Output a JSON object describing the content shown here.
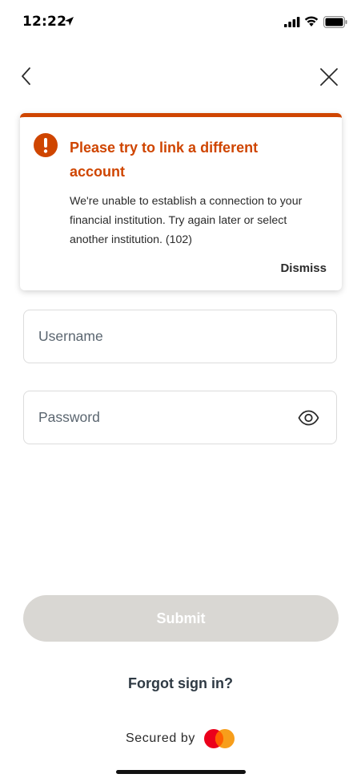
{
  "status_bar": {
    "time": "12:22",
    "icons": [
      "location-arrow-icon",
      "cellular-signal-icon",
      "wifi-icon",
      "battery-icon"
    ]
  },
  "nav": {
    "back_icon": "chevron-left-icon",
    "close_icon": "close-icon"
  },
  "alert": {
    "icon": "exclamation-circle-icon",
    "title": "Please try to link a different account",
    "message": "We're unable to establish a connection to your financial institution. Try again later or select another institution. (102)",
    "dismiss_label": "Dismiss",
    "color": "#cf4500"
  },
  "form": {
    "username": {
      "placeholder": "Username",
      "value": ""
    },
    "password": {
      "placeholder": "Password",
      "value": "",
      "toggle_icon": "eye-icon"
    },
    "submit_label": "Submit",
    "submit_color": "#d9d7d3"
  },
  "footer": {
    "forgot_label": "Forgot sign in?",
    "secured_label": "Secured by",
    "logo_icon": "mastercard-logo-icon"
  }
}
